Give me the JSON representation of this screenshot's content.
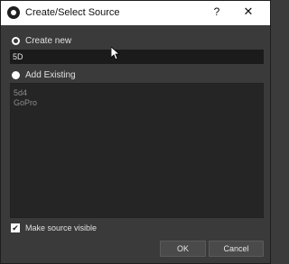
{
  "window": {
    "title": "Create/Select Source",
    "help_label": "?",
    "close_label": "✕"
  },
  "create_new": {
    "label": "Create new",
    "selected": true,
    "name_value": "5D"
  },
  "add_existing": {
    "label": "Add Existing",
    "selected": false,
    "items": [
      "5d4",
      "GoPro"
    ]
  },
  "make_visible": {
    "label": "Make source visible",
    "checked": true,
    "check_glyph": "✔"
  },
  "buttons": {
    "ok": "OK",
    "cancel": "Cancel"
  },
  "icons": {
    "app": "obs-logo-icon",
    "help": "help-icon",
    "close": "close-icon",
    "cursor": "mouse-pointer-icon"
  }
}
